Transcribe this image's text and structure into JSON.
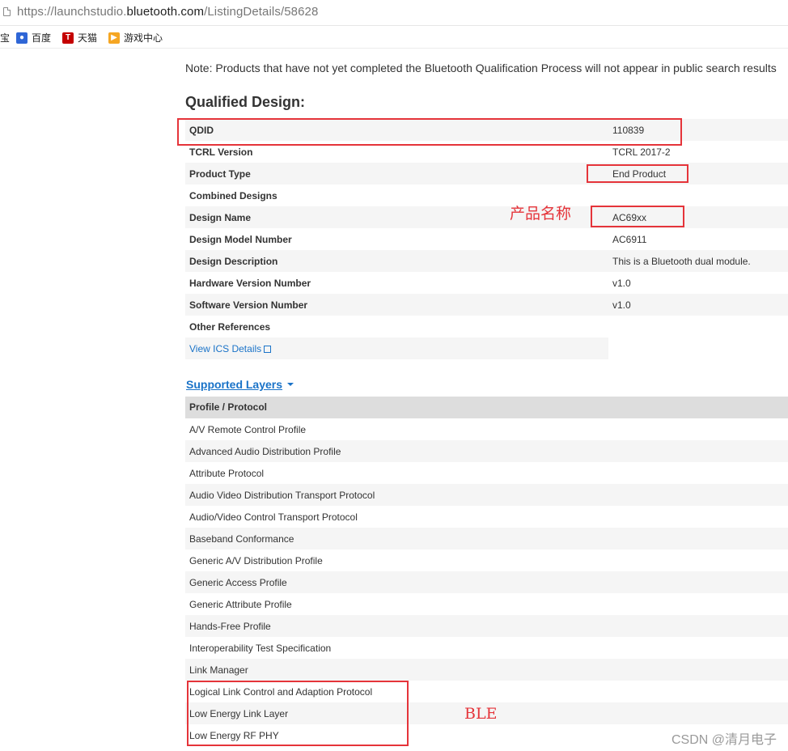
{
  "browser": {
    "url_prefix": "https://launchstudio.",
    "url_host": "bluetooth.com",
    "url_path": "/ListingDetails/58628",
    "bookmarks": [
      {
        "label": "宝",
        "icon": "none",
        "color": ""
      },
      {
        "label": "百度",
        "icon": "baidu-paw-icon",
        "color": "#2f66d6"
      },
      {
        "label": "天猫",
        "icon": "tmall-t-icon",
        "glyph": "T",
        "color": "#c40000"
      },
      {
        "label": "游戏中心",
        "icon": "game-center-icon",
        "color": "#f5a623"
      }
    ]
  },
  "page": {
    "note": "Note: Products that have not yet completed the Bluetooth Qualification Process will not appear in public search results",
    "qualified_title": "Qualified Design:",
    "design_rows": [
      {
        "key": "QDID",
        "value": "110839"
      },
      {
        "key": "TCRL Version",
        "value": "TCRL 2017-2"
      },
      {
        "key": "Product Type",
        "value": "End Product"
      },
      {
        "key": "Combined Designs",
        "value": ""
      },
      {
        "key": "Design Name",
        "value": "AC69xx"
      },
      {
        "key": "Design Model Number",
        "value": "AC6911"
      },
      {
        "key": "Design Description",
        "value": "This is a Bluetooth dual module."
      },
      {
        "key": "Hardware Version Number",
        "value": "v1.0"
      },
      {
        "key": "Software Version Number",
        "value": "v1.0"
      },
      {
        "key": "Other References",
        "value": ""
      }
    ],
    "ics_link": "View ICS Details",
    "supported_layers": "Supported Layers",
    "table_header": "Profile / Protocol",
    "layers": [
      "A/V Remote Control Profile",
      "Advanced Audio Distribution Profile",
      "Attribute Protocol",
      "Audio Video Distribution Transport Protocol",
      "Audio/Video Control Transport Protocol",
      "Baseband Conformance",
      "Generic A/V Distribution Profile",
      "Generic Access Profile",
      "Generic Attribute Profile",
      "Hands-Free Profile",
      "Interoperability Test Specification",
      "Link Manager",
      "Logical Link Control and Adaption Protocol",
      "Low Energy Link Layer",
      "Low Energy RF PHY"
    ]
  },
  "annotations": {
    "product_name": "产品名称",
    "ble": "BLE",
    "color": "#e5343a"
  },
  "watermark": "CSDN @清月电子"
}
